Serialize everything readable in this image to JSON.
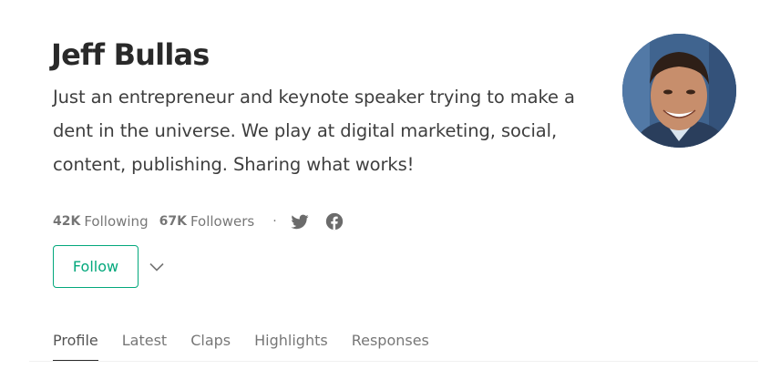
{
  "profile": {
    "name": "Jeff Bullas",
    "bio": "Just an entrepreneur and keynote speaker trying to make a dent in the universe. We play at digital marketing, social, content, publishing. Sharing what works!",
    "following_count": "42K",
    "following_label": "Following",
    "followers_count": "67K",
    "followers_label": "Followers",
    "separator": "·",
    "social_icons": [
      "twitter-icon",
      "facebook-icon"
    ]
  },
  "actions": {
    "follow_label": "Follow",
    "more_icon": "chevron-down-icon"
  },
  "tabs": [
    {
      "label": "Profile",
      "active": true
    },
    {
      "label": "Latest",
      "active": false
    },
    {
      "label": "Claps",
      "active": false
    },
    {
      "label": "Highlights",
      "active": false
    },
    {
      "label": "Responses",
      "active": false
    }
  ],
  "colors": {
    "accent": "#03a87c",
    "text": "#292929",
    "muted": "#757575"
  }
}
